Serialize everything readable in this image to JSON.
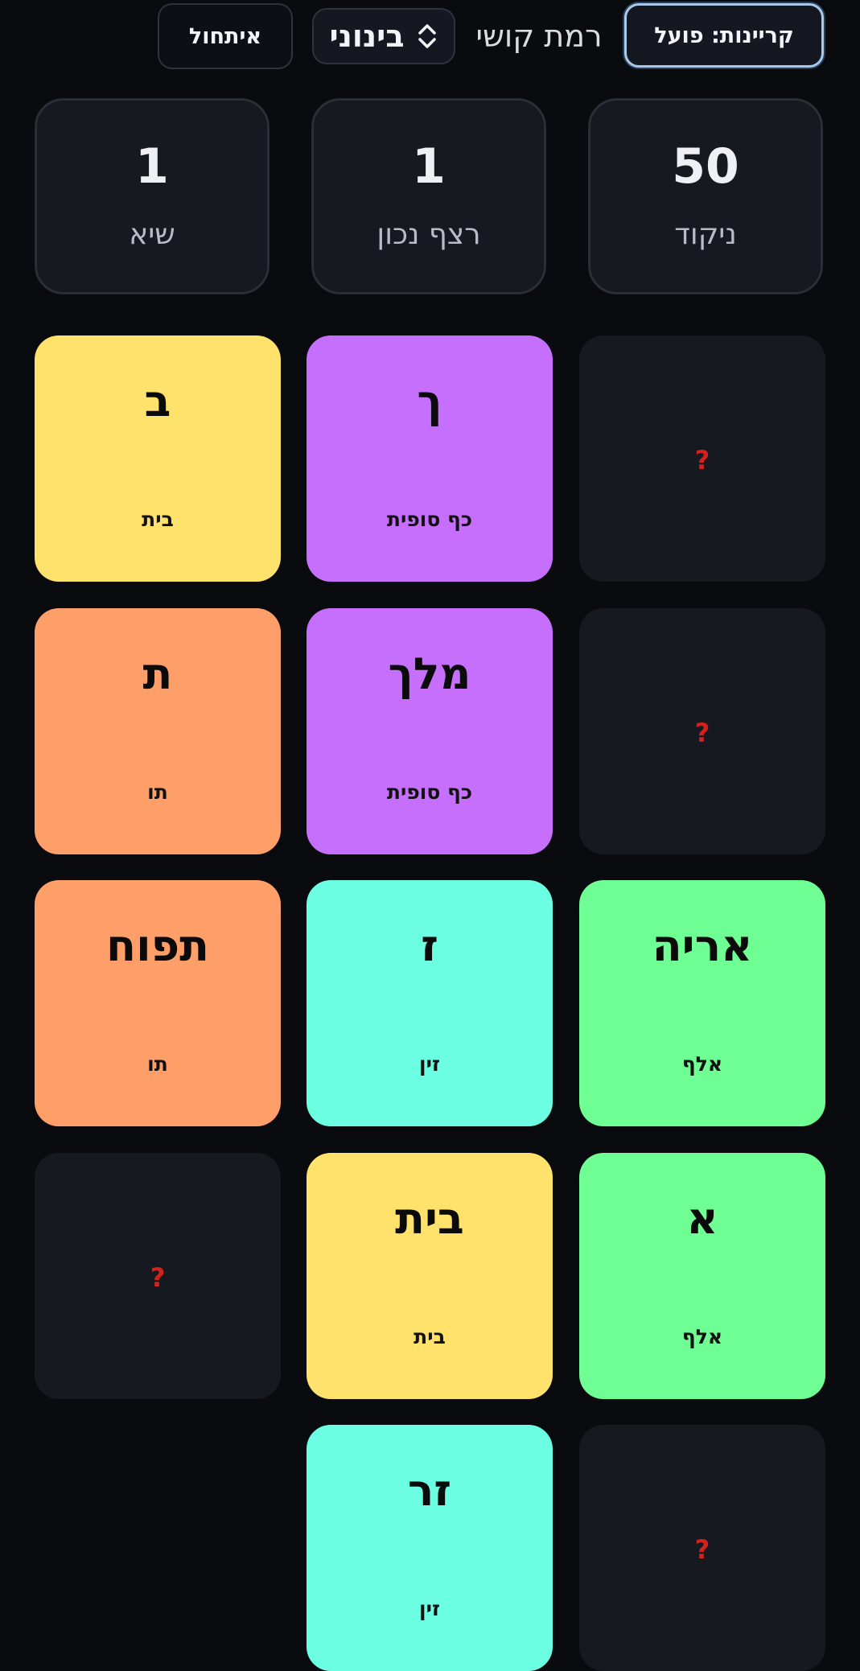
{
  "toolbar": {
    "narration_button": "קריינות: פועל",
    "difficulty_label": "רמת קושי",
    "difficulty_value": "בינוני",
    "reset_button": "איתחול"
  },
  "stats": {
    "score": {
      "value": "50",
      "label": "ניקוד"
    },
    "streak": {
      "value": "1",
      "label": "רצף נכון"
    },
    "record": {
      "value": "1",
      "label": "שיא"
    }
  },
  "cards": {
    "r1c1": {
      "hidden": true,
      "mark": "?"
    },
    "r1c2": {
      "glyph": "ך",
      "name": "כף סופית",
      "color": "#c66ffd"
    },
    "r1c3": {
      "glyph": "ב",
      "name": "בית",
      "color": "#fee26c"
    },
    "r2c1": {
      "hidden": true,
      "mark": "?"
    },
    "r2c2": {
      "glyph": "מלך",
      "name": "כף סופית",
      "color": "#c66ffd"
    },
    "r2c3": {
      "glyph": "ת",
      "name": "תו",
      "color": "#fe9f6a"
    },
    "r3c1": {
      "glyph": "אריה",
      "name": "אלף",
      "color": "#6efe94"
    },
    "r3c2": {
      "glyph": "ז",
      "name": "זין",
      "color": "#6cfee3"
    },
    "r3c3": {
      "glyph": "תפוח",
      "name": "תו",
      "color": "#fe9f6a"
    },
    "r4c1": {
      "glyph": "א",
      "name": "אלף",
      "color": "#6efe94"
    },
    "r4c2": {
      "glyph": "בית",
      "name": "בית",
      "color": "#fee26c"
    },
    "r4c3": {
      "hidden": true,
      "mark": "?"
    },
    "r5c1": {
      "hidden": true,
      "mark": "?"
    },
    "r5c2": {
      "glyph": "זר",
      "name": "זין",
      "color": "#6cfee3"
    }
  }
}
